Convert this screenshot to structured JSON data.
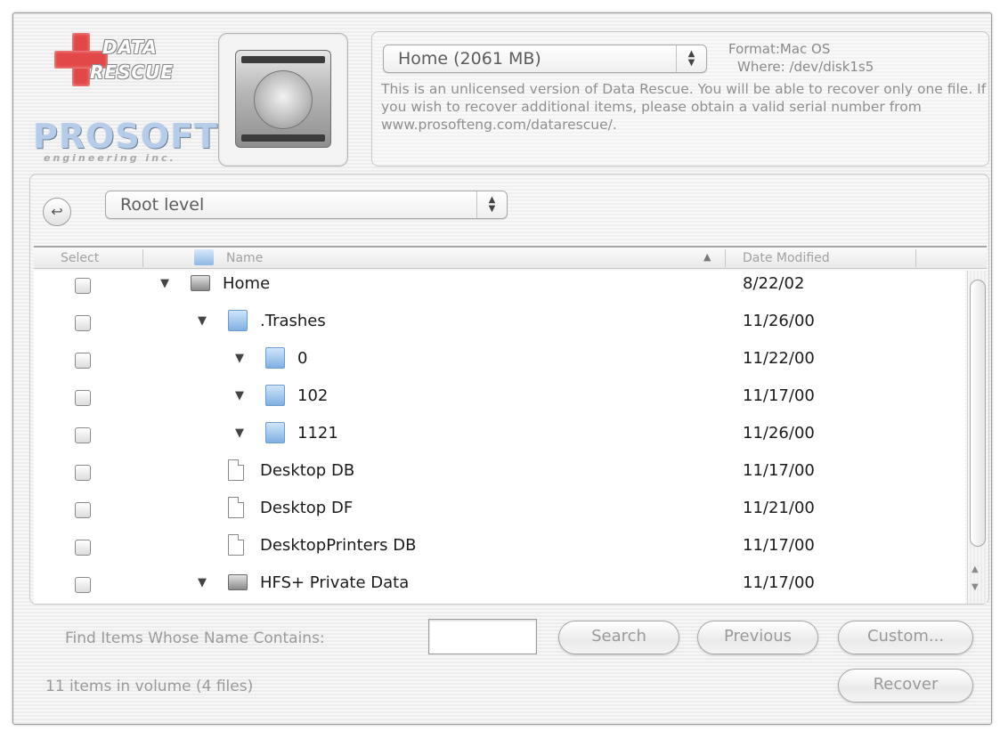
{
  "logo": {
    "cross_word_1": "DATA",
    "cross_word_2": "RESCUE",
    "company": "PROSOFT",
    "company_sub": "engineering inc."
  },
  "volume": {
    "selected": "Home (2061 MB)",
    "format": "Format:Mac OS",
    "where": "Where: /dev/disk1s5",
    "notice": "This is an unlicensed version of Data Rescue. You will be able to recover only one file. If you wish to recover additional items, please obtain a valid serial number from www.prosofteng.com/datarescue/."
  },
  "navigation": {
    "back_icon": "back-arrow-icon",
    "level": "Root level"
  },
  "columns": {
    "select": "Select",
    "name": "Name",
    "date": "Date Modified",
    "sort_indicator": "▲"
  },
  "rows": [
    {
      "name": "Home",
      "date": "8/22/02",
      "icon": "disk",
      "indent": 0,
      "expanded": true
    },
    {
      "name": ".Trashes",
      "date": "11/26/00",
      "icon": "folder",
      "indent": 1,
      "expanded": true
    },
    {
      "name": "0",
      "date": "11/22/00",
      "icon": "folder",
      "indent": 2,
      "expanded": true
    },
    {
      "name": "102",
      "date": "11/17/00",
      "icon": "folder",
      "indent": 2,
      "expanded": true
    },
    {
      "name": "1121",
      "date": "11/26/00",
      "icon": "folder",
      "indent": 2,
      "expanded": true
    },
    {
      "name": "Desktop DB",
      "date": "11/17/00",
      "icon": "file",
      "indent": 1,
      "expanded": false
    },
    {
      "name": "Desktop DF",
      "date": "11/21/00",
      "icon": "file",
      "indent": 1,
      "expanded": false
    },
    {
      "name": "DesktopPrinters DB",
      "date": "11/17/00",
      "icon": "file",
      "indent": 1,
      "expanded": false
    },
    {
      "name": "HFS+ Private Data",
      "date": "11/17/00",
      "icon": "disk",
      "indent": 1,
      "expanded": true
    }
  ],
  "find": {
    "label": "Find Items Whose Name Contains:",
    "value": ""
  },
  "buttons": {
    "search": "Search",
    "previous": "Previous",
    "custom": "Custom...",
    "recover": "Recover"
  },
  "status": "11 items in volume (4 files)",
  "colors": {
    "logo_red": "#e24848",
    "prosoft_blue": "#b6cce8",
    "folder_blue": "#7fb0e3"
  }
}
